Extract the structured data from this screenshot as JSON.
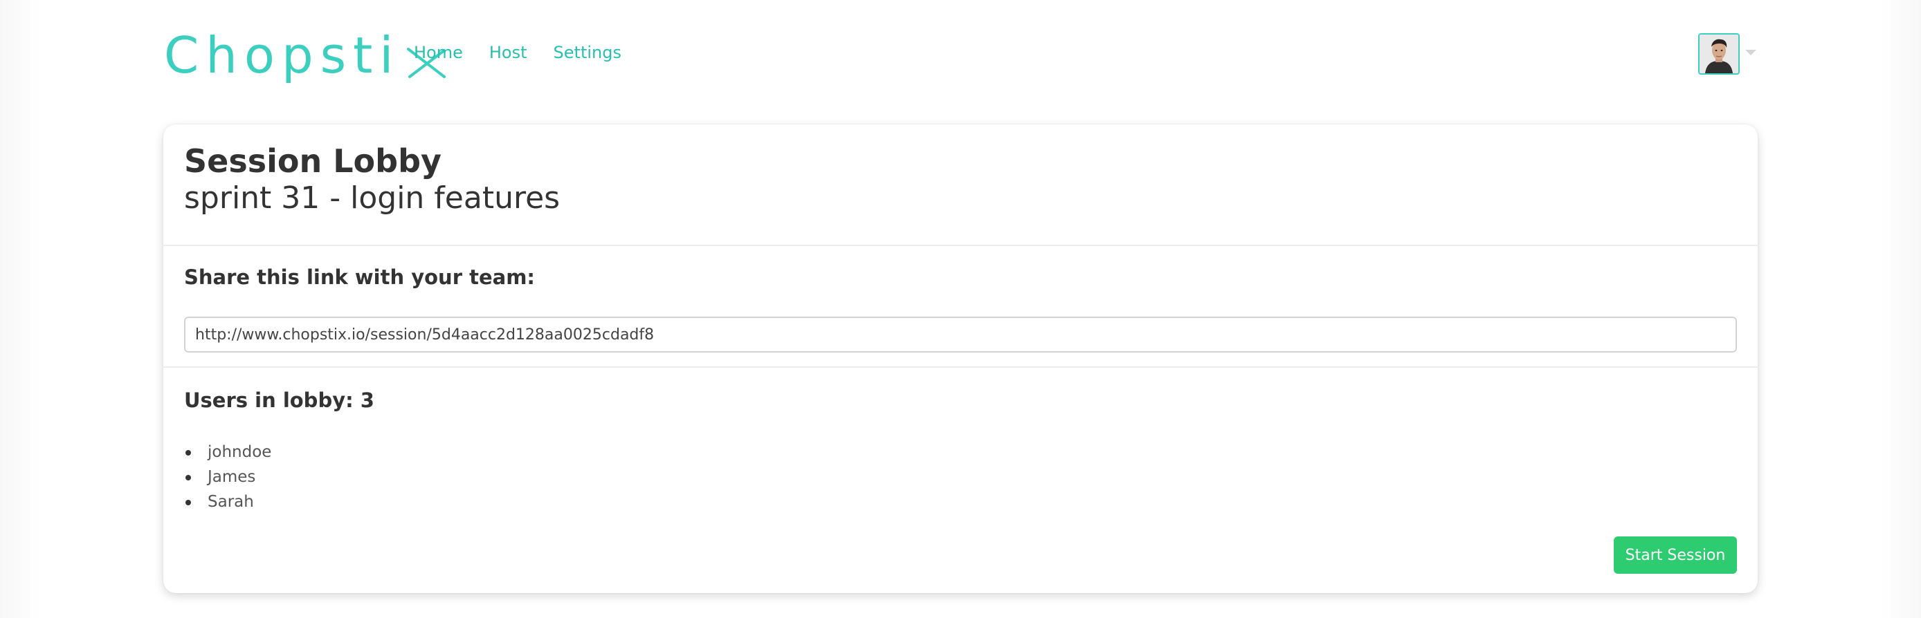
{
  "brand": {
    "logo_text": "Chopsti",
    "logo_color": "#3ccfbf"
  },
  "nav": {
    "items": [
      {
        "label": "Home"
      },
      {
        "label": "Host"
      },
      {
        "label": "Settings"
      }
    ],
    "link_color": "#27bfae"
  },
  "user_menu": {
    "avatar_icon": "user-avatar",
    "caret_icon": "chevron-down-icon"
  },
  "session": {
    "title": "Session Lobby",
    "name": "sprint 31 - login features",
    "share_label": "Share this link with your team:",
    "share_link": "http://www.chopstix.io/session/5d4aacc2d128aa0025cdadf8",
    "lobby_label": "Users in lobby: 3",
    "users": [
      "johndoe",
      "James",
      "Sarah"
    ],
    "start_button_label": "Start Session",
    "start_button_color": "#2ecc71"
  }
}
